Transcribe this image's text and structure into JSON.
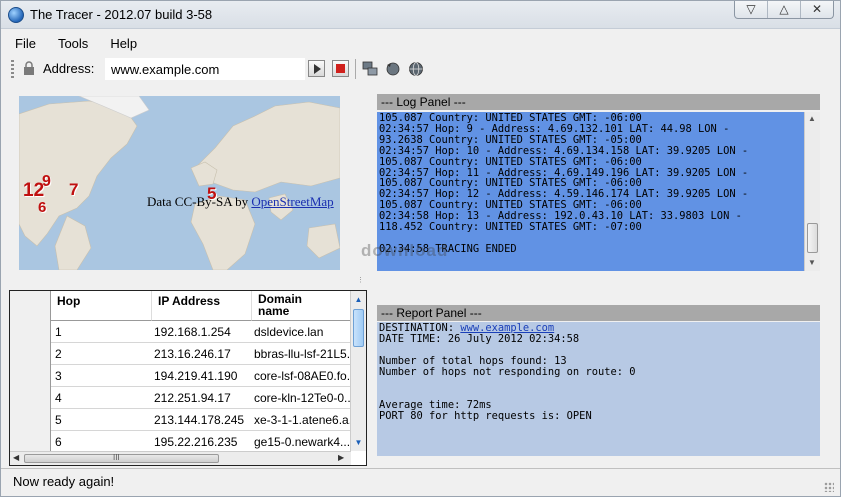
{
  "window": {
    "title": "The Tracer - 2012.07 build 3-58",
    "controls": [
      "▽",
      "△",
      "✕"
    ]
  },
  "menu": {
    "items": [
      "File",
      "Tools",
      "Help"
    ]
  },
  "address": {
    "label": "Address:",
    "value": "www.example.com"
  },
  "map": {
    "attribution_prefix": "Data CC-By-SA by ",
    "attribution_link": "OpenStreetMap",
    "markers": [
      "12",
      "9",
      "6",
      "7",
      "5"
    ]
  },
  "hop_table": {
    "columns": [
      "Hop",
      "IP Address",
      "Domain\nname"
    ],
    "rows": [
      {
        "hop": "1",
        "ip": "192.168.1.254",
        "domain": "dsldevice.lan"
      },
      {
        "hop": "2",
        "ip": "213.16.246.17",
        "domain": "bbras-llu-lsf-21L5..."
      },
      {
        "hop": "3",
        "ip": "194.219.41.190",
        "domain": "core-lsf-08AE0.fo..."
      },
      {
        "hop": "4",
        "ip": "212.251.94.17",
        "domain": "core-kln-12Te0-0..."
      },
      {
        "hop": "5",
        "ip": "213.144.178.245",
        "domain": "xe-3-1-1.atene6.a..."
      },
      {
        "hop": "6",
        "ip": "195.22.216.235",
        "domain": "ge15-0.newark4...."
      }
    ],
    "scroll_glyph": "III"
  },
  "log_panel": {
    "title": "--- Log Panel ---",
    "text": "105.087 Country: UNITED STATES GMT: -06:00\n02:34:57 Hop: 9 - Address: 4.69.132.101 LAT: 44.98 LON -\n93.2638 Country: UNITED STATES GMT: -05:00\n02:34:57 Hop: 10 - Address: 4.69.134.158 LAT: 39.9205 LON -\n105.087 Country: UNITED STATES GMT: -06:00\n02:34:57 Hop: 11 - Address: 4.69.149.196 LAT: 39.9205 LON -\n105.087 Country: UNITED STATES GMT: -06:00\n02:34:57 Hop: 12 - Address: 4.59.146.174 LAT: 39.9205 LON -\n105.087 Country: UNITED STATES GMT: -06:00\n02:34:58 Hop: 13 - Address: 192.0.43.10 LAT: 33.9803 LON -\n118.452 Country: UNITED STATES GMT: -07:00\n\n02:34:58 TRACING ENDED"
  },
  "report_panel": {
    "title": "--- Report Panel ---",
    "destination_label": "DESTINATION: ",
    "destination_value": "www.example.com",
    "body": "DATE TIME: 26 July 2012 02:34:58\n\nNumber of total hops found: 13\nNumber of hops not responding on route: 0\n\n\nAverage time: 72ms\nPORT 80 for http requests is: OPEN"
  },
  "status": {
    "text": "Now ready again!"
  },
  "watermark": "download"
}
